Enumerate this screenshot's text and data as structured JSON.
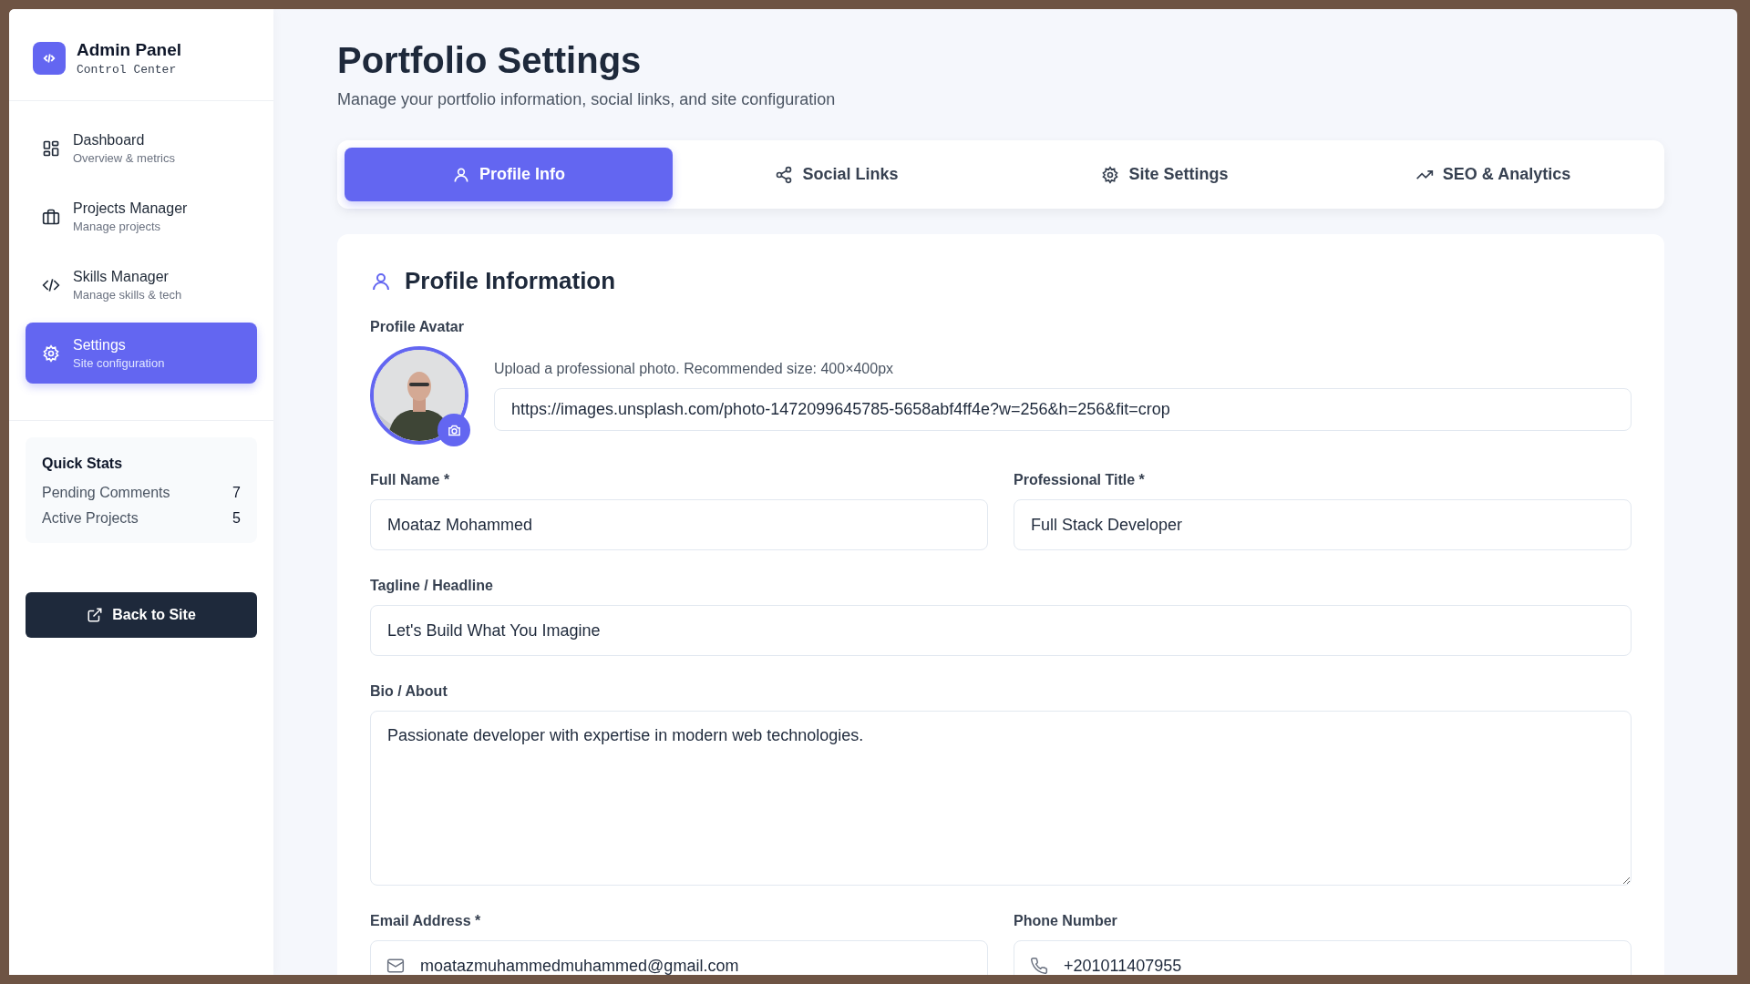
{
  "sidebar": {
    "brand": {
      "title": "Admin Panel",
      "subtitle": "Control Center"
    },
    "items": [
      {
        "kind": "grid",
        "label": "Dashboard",
        "description": "Overview & metrics",
        "selected": false
      },
      {
        "kind": "briefcase",
        "label": "Projects Manager",
        "description": "Manage projects",
        "selected": false
      },
      {
        "kind": "code",
        "label": "Skills Manager",
        "description": "Manage skills & tech",
        "selected": false
      },
      {
        "kind": "gear",
        "label": "Settings",
        "description": "Site configuration",
        "selected": true
      }
    ],
    "quick_stats": {
      "title": "Quick Stats",
      "rows": [
        {
          "label": "Pending Comments",
          "value": "7"
        },
        {
          "label": "Active Projects",
          "value": "5"
        }
      ]
    },
    "back_button": "Back to Site"
  },
  "page": {
    "title": "Portfolio Settings",
    "subtitle": "Manage your portfolio information, social links, and site configuration"
  },
  "tabs": [
    {
      "kind": "user",
      "label": "Profile Info",
      "selected": true
    },
    {
      "kind": "share",
      "label": "Social Links",
      "selected": false
    },
    {
      "kind": "gear",
      "label": "Site Settings",
      "selected": false
    },
    {
      "kind": "trend",
      "label": "SEO & Analytics",
      "selected": false
    }
  ],
  "form": {
    "heading": "Profile Information",
    "avatar": {
      "label": "Profile Avatar",
      "hint": "Upload a professional photo. Recommended size: 400×400px",
      "url": "https://images.unsplash.com/photo-1472099645785-5658abf4ff4e?w=256&h=256&fit=crop"
    },
    "full_name": {
      "label": "Full Name *",
      "value": "Moataz Mohammed"
    },
    "professional_title": {
      "label": "Professional Title *",
      "value": "Full Stack Developer"
    },
    "tagline": {
      "label": "Tagline / Headline",
      "value": "Let's Build What You Imagine"
    },
    "bio": {
      "label": "Bio / About",
      "value": "Passionate developer with expertise in modern web technologies."
    },
    "email": {
      "label": "Email Address *",
      "value": "moatazmuhammedmuhammed@gmail.com"
    },
    "phone": {
      "label": "Phone Number",
      "value": "+201011407955"
    }
  }
}
